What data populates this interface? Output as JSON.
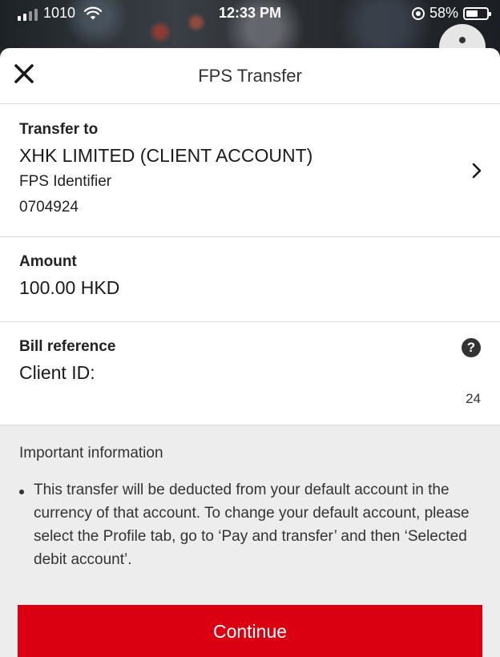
{
  "status_bar": {
    "carrier": "1010",
    "time": "12:33 PM",
    "battery": "58%",
    "battery_level": 0.58
  },
  "header": {
    "title": "FPS Transfer",
    "close_icon": "close-icon"
  },
  "transfer_to": {
    "label": "Transfer to",
    "name": "XHK LIMITED (CLIENT ACCOUNT)",
    "id_label": "FPS Identifier",
    "id_value": "0704924"
  },
  "amount": {
    "label": "Amount",
    "value": "100.00 HKD"
  },
  "bill_reference": {
    "label": "Bill reference",
    "value": "Client ID:",
    "remaining_chars": "24",
    "help_icon": "?"
  },
  "info": {
    "title": "Important information",
    "items": [
      "This transfer will be deducted from your default account in the currency of that account. To change your default account, please select the Profile tab, go to ‘Pay and transfer’ and then ‘Selected debit account’."
    ]
  },
  "actions": {
    "continue_label": "Continue"
  },
  "colors": {
    "primary": "#db0011",
    "info_bg": "#ededed"
  }
}
